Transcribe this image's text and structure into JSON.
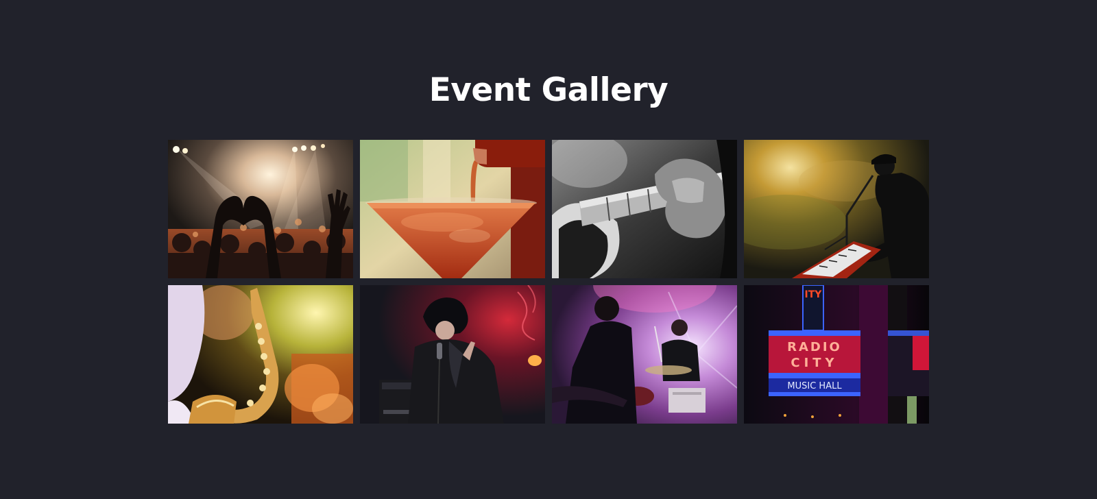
{
  "page": {
    "title": "Event Gallery",
    "background": "#21222b",
    "title_color": "#ffffff"
  },
  "gallery": {
    "photos": [
      {
        "subject": "concert-crowd-heart-hands",
        "icon": "concert-crowd-photo"
      },
      {
        "subject": "cocktail-being-poured",
        "icon": "cocktail-photo"
      },
      {
        "subject": "guitar-player-black-white",
        "icon": "guitar-photo"
      },
      {
        "subject": "keyboard-singer-smoke",
        "icon": "keyboard-singer-photo"
      },
      {
        "subject": "saxophone-player",
        "icon": "saxophone-photo"
      },
      {
        "subject": "rock-singer-microphone",
        "icon": "rock-singer-photo"
      },
      {
        "subject": "band-guitarist-drummer",
        "icon": "band-photo"
      },
      {
        "subject": "radio-city-music-hall-neon-sign",
        "icon": "neon-sign-photo",
        "sign_top": "ITY",
        "sign_line_1": "RADIO",
        "sign_line_2": "CITY",
        "sign_line_3": "MUSIC HALL"
      }
    ]
  }
}
